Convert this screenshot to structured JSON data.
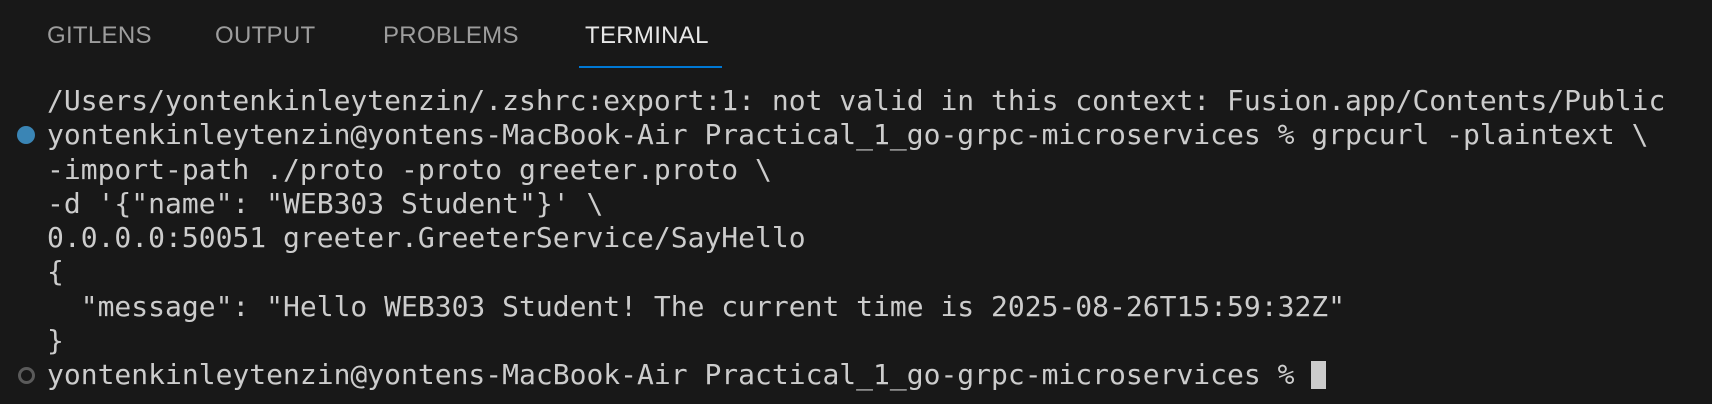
{
  "tabs": [
    {
      "label": "GITLENS",
      "active": false
    },
    {
      "label": "OUTPUT",
      "active": false
    },
    {
      "label": "PROBLEMS",
      "active": false
    },
    {
      "label": "TERMINAL",
      "active": true
    }
  ],
  "accent_color": "#0078d4",
  "terminal": {
    "lines": [
      "/Users/yontenkinleytenzin/.zshrc:export:1: not valid in this context: Fusion.app/Contents/Public",
      "yontenkinleytenzin@yontens-MacBook-Air Practical_1_go-grpc-microservices % grpcurl -plaintext \\",
      "-import-path ./proto -proto greeter.proto \\",
      "-d '{\"name\": \"WEB303 Student\"}' \\",
      "0.0.0.0:50051 greeter.GreeterService/SayHello",
      "{",
      "  \"message\": \"Hello WEB303 Student! The current time is 2025-08-26T15:59:32Z\"",
      "}",
      "yontenkinleytenzin@yontens-MacBook-Air Practical_1_go-grpc-microservices % "
    ],
    "command_status": {
      "previous": "success",
      "current": "pending"
    }
  }
}
